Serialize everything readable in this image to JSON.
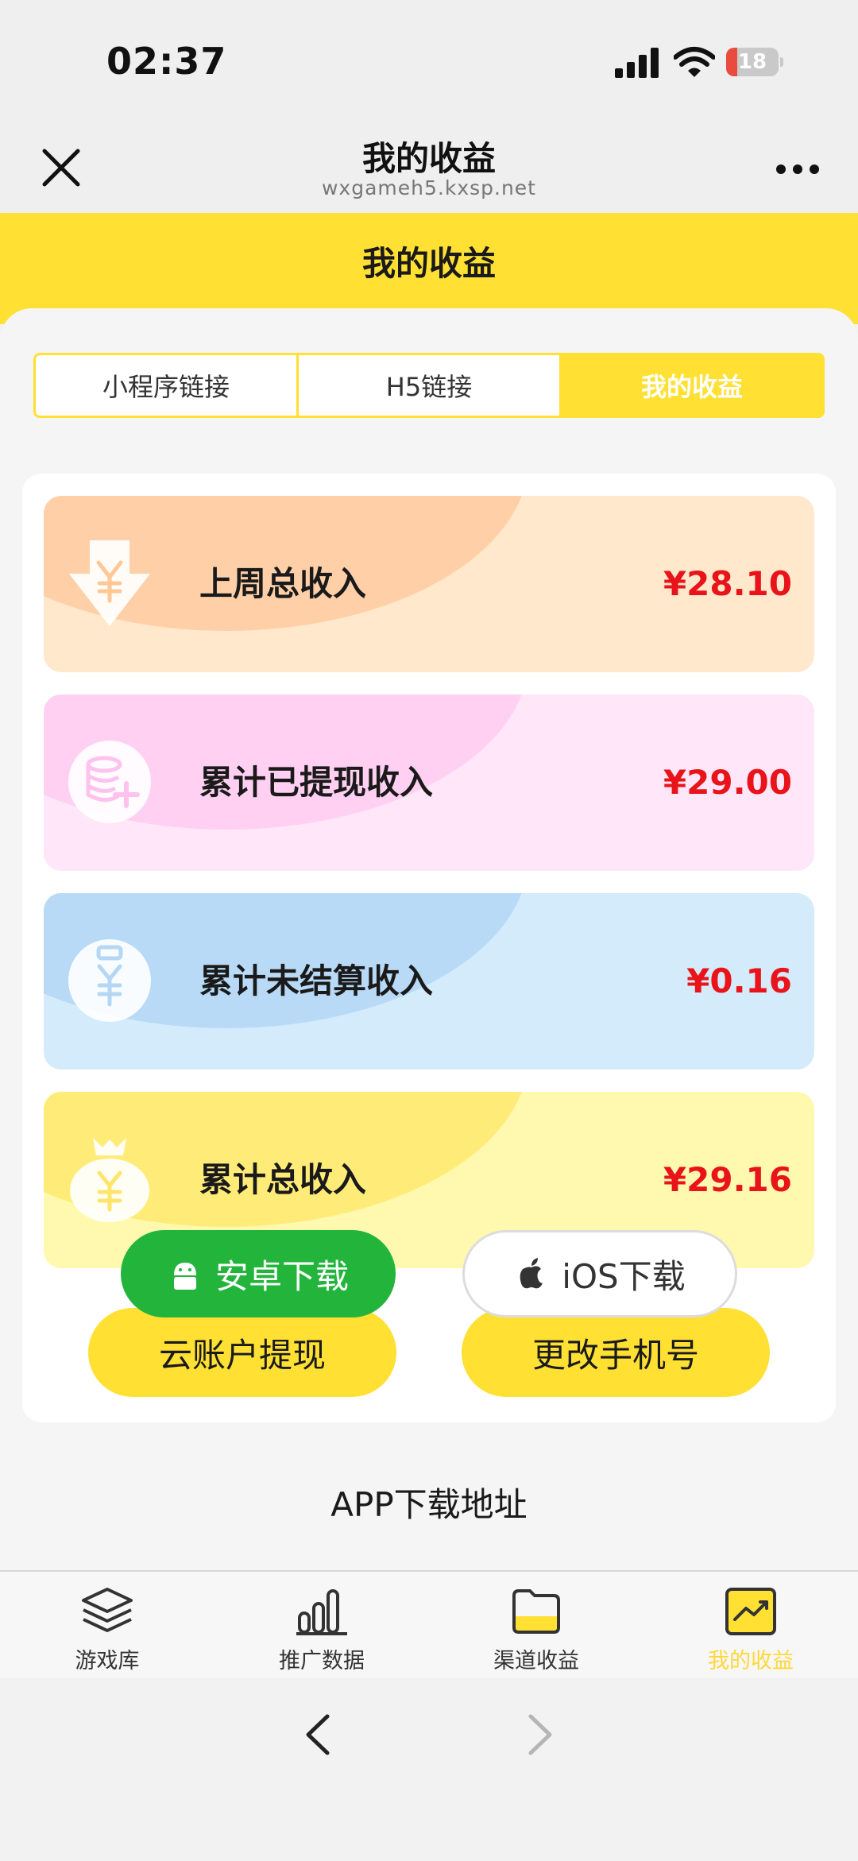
{
  "status_bar": {
    "time": "02:37",
    "battery": "18"
  },
  "nav": {
    "title": "我的收益",
    "url": "wxgameh5.kxsp.net"
  },
  "header": {
    "title": "我的收益"
  },
  "tabs": [
    {
      "label": "小程序链接",
      "active": false
    },
    {
      "label": "H5链接",
      "active": false
    },
    {
      "label": "我的收益",
      "active": true
    }
  ],
  "stats": [
    {
      "label": "上周总收入",
      "value": "¥28.10",
      "icon": "download-yen-icon"
    },
    {
      "label": "累计已提现收入",
      "value": "¥29.00",
      "icon": "coins-plus-icon"
    },
    {
      "label": "累计未结算收入",
      "value": "¥0.16",
      "icon": "clipboard-yen-icon"
    },
    {
      "label": "累计总收入",
      "value": "¥29.16",
      "icon": "money-bag-icon"
    }
  ],
  "actions": {
    "withdraw": "云账户提现",
    "change_phone": "更改手机号"
  },
  "app_download": {
    "title": "APP下载地址",
    "android": "安卓下载",
    "ios": "iOS下载"
  },
  "tabbar": [
    {
      "label": "游戏库",
      "icon": "layers-icon"
    },
    {
      "label": "推广数据",
      "icon": "bar-chart-icon"
    },
    {
      "label": "渠道收益",
      "icon": "folder-icon"
    },
    {
      "label": "我的收益",
      "icon": "trend-chart-icon",
      "active": true
    }
  ],
  "colors": {
    "accent": "#ffe033",
    "value_red": "#e8141a",
    "active_tab_label": "#ffd83a",
    "android_green": "#23b53b"
  }
}
